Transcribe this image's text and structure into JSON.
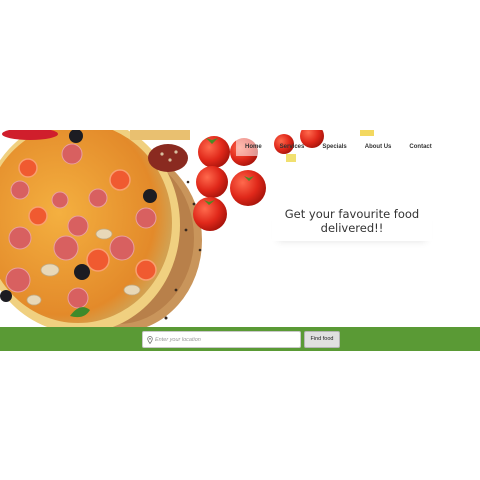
{
  "nav": {
    "items": [
      {
        "label": "Home",
        "active": true
      },
      {
        "label": "Services",
        "active": false
      },
      {
        "label": "Specials",
        "active": false
      },
      {
        "label": "About Us",
        "active": false
      },
      {
        "label": "Contact",
        "active": false
      }
    ]
  },
  "hero": {
    "tagline": "Get your favourite food delivered!!"
  },
  "search": {
    "placeholder": "Enter your location",
    "button_label": "Find food",
    "pin_icon": "map-pin-icon"
  },
  "colors": {
    "search_bar": "#5a9a35",
    "button_bg": "#e0e0e0",
    "text": "#333333"
  }
}
